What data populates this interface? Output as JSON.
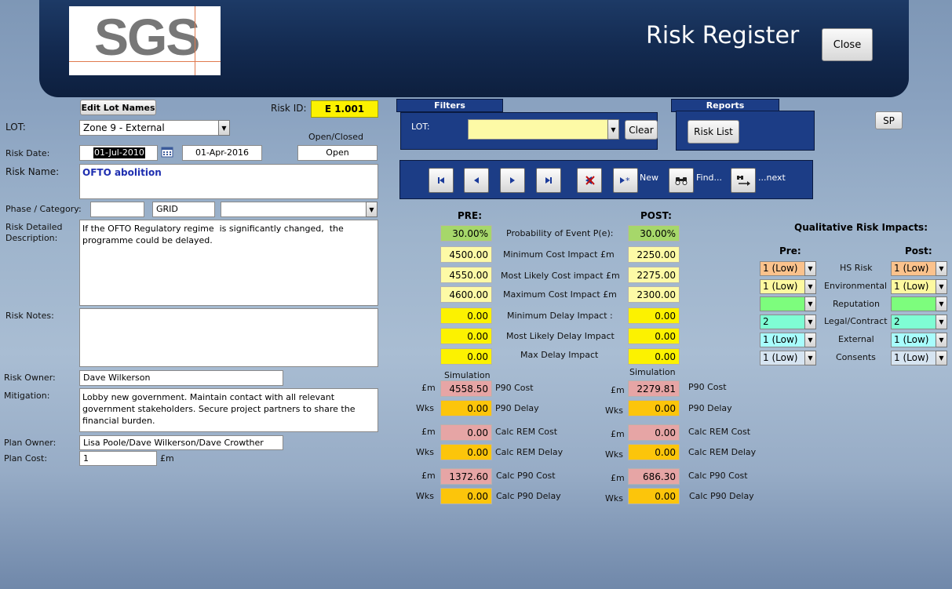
{
  "header": {
    "logo_text": "SGS",
    "title": "Risk Register",
    "close_label": "Close"
  },
  "form": {
    "edit_lot_names_label": "Edit Lot Names",
    "risk_id_label": "Risk ID:",
    "risk_id_value": "E 1.001",
    "lot_label": "LOT:",
    "lot_value": "Zone 9 - External",
    "risk_date_label": "Risk Date:",
    "risk_date_value": "01-Jul-2010",
    "second_date_value": "01-Apr-2016",
    "open_closed_label": "Open/Closed",
    "open_closed_value": "Open",
    "risk_name_label": "Risk Name:",
    "risk_name_value": "OFTO abolition",
    "phase_category_label": "Phase / Category:",
    "phase_value": "",
    "category_value": "GRID",
    "subcategory_value": "",
    "risk_desc_label_1": "Risk Detailed",
    "risk_desc_label_2": "Description:",
    "risk_desc_value": "If the OFTO Regulatory regime  is significantly changed,  the\nprogramme could be delayed.",
    "risk_notes_label": "Risk Notes:",
    "risk_notes_value": "",
    "risk_owner_label": "Risk Owner:",
    "risk_owner_value": "Dave Wilkerson",
    "mitigation_label": "Mitigation:",
    "mitigation_value": "Lobby new government. Maintain contact with all relevant\ngovernment stakeholders. Secure project partners to share the\nfinancial burden.",
    "plan_owner_label": "Plan Owner:",
    "plan_owner_value": "Lisa Poole/Dave Wilkerson/Dave Crowther",
    "plan_cost_label": "Plan Cost:",
    "plan_cost_value": "1",
    "plan_cost_unit": "£m"
  },
  "filters": {
    "tab_label": "Filters",
    "lot_label": "LOT:",
    "lot_value": "",
    "clear_label": "Clear"
  },
  "reports": {
    "tab_label": "Reports",
    "risk_list_label": "Risk List"
  },
  "sp_label": "SP",
  "nav": {
    "new_label": "New",
    "find_label": "Find...",
    "next_label": "...next"
  },
  "impacts": {
    "pre_label": "PRE:",
    "post_label": "POST:",
    "rows": [
      {
        "label": "Probability of Event P(e):",
        "pre": "30.00%",
        "post": "30.00%"
      },
      {
        "label": "Minimum Cost Impact  £m",
        "pre": "4500.00",
        "post": "2250.00"
      },
      {
        "label": "Most Likely Cost impact £m",
        "pre": "4550.00",
        "post": "2275.00"
      },
      {
        "label": "Maximum Cost Impact £m",
        "pre": "4600.00",
        "post": "2300.00"
      },
      {
        "label": "Minimum Delay Impact :",
        "pre": "0.00",
        "post": "0.00"
      },
      {
        "label": "Most Likely Delay Impact",
        "pre": "0.00",
        "post": "0.00"
      },
      {
        "label": "Max Delay Impact",
        "pre": "0.00",
        "post": "0.00"
      }
    ]
  },
  "simulation": {
    "label": "Simulation",
    "unit_m": "£m",
    "unit_wks": "Wks",
    "rows": [
      {
        "label": "P90 Cost",
        "pre": "4558.50",
        "post": "2279.81"
      },
      {
        "label": "P90  Delay",
        "pre": "0.00",
        "post": "0.00"
      },
      {
        "label": "Calc REM Cost",
        "pre": "0.00",
        "post": "0.00"
      },
      {
        "label": "Calc REM  Delay",
        "pre": "0.00",
        "post": "0.00"
      },
      {
        "label": "Calc P90 Cost",
        "pre": "1372.60",
        "post": "686.30"
      },
      {
        "label": "Calc P90  Delay",
        "pre": "0.00",
        "post": "0.00"
      }
    ]
  },
  "qualitative": {
    "title": "Qualitative Risk Impacts:",
    "pre_label": "Pre:",
    "post_label": "Post:",
    "rows": [
      {
        "label": "HS Risk",
        "pre": "1 (Low)",
        "post": "1 (Low)"
      },
      {
        "label": "Environmental",
        "pre": "1 (Low)",
        "post": "1 (Low)"
      },
      {
        "label": "Reputation",
        "pre": "",
        "post": ""
      },
      {
        "label": "Legal/Contract",
        "pre": "2",
        "post": "2"
      },
      {
        "label": "External",
        "pre": "1 (Low)",
        "post": "1 (Low)"
      },
      {
        "label": "Consents",
        "pre": "1 (Low)",
        "post": "1 (Low)"
      }
    ]
  }
}
